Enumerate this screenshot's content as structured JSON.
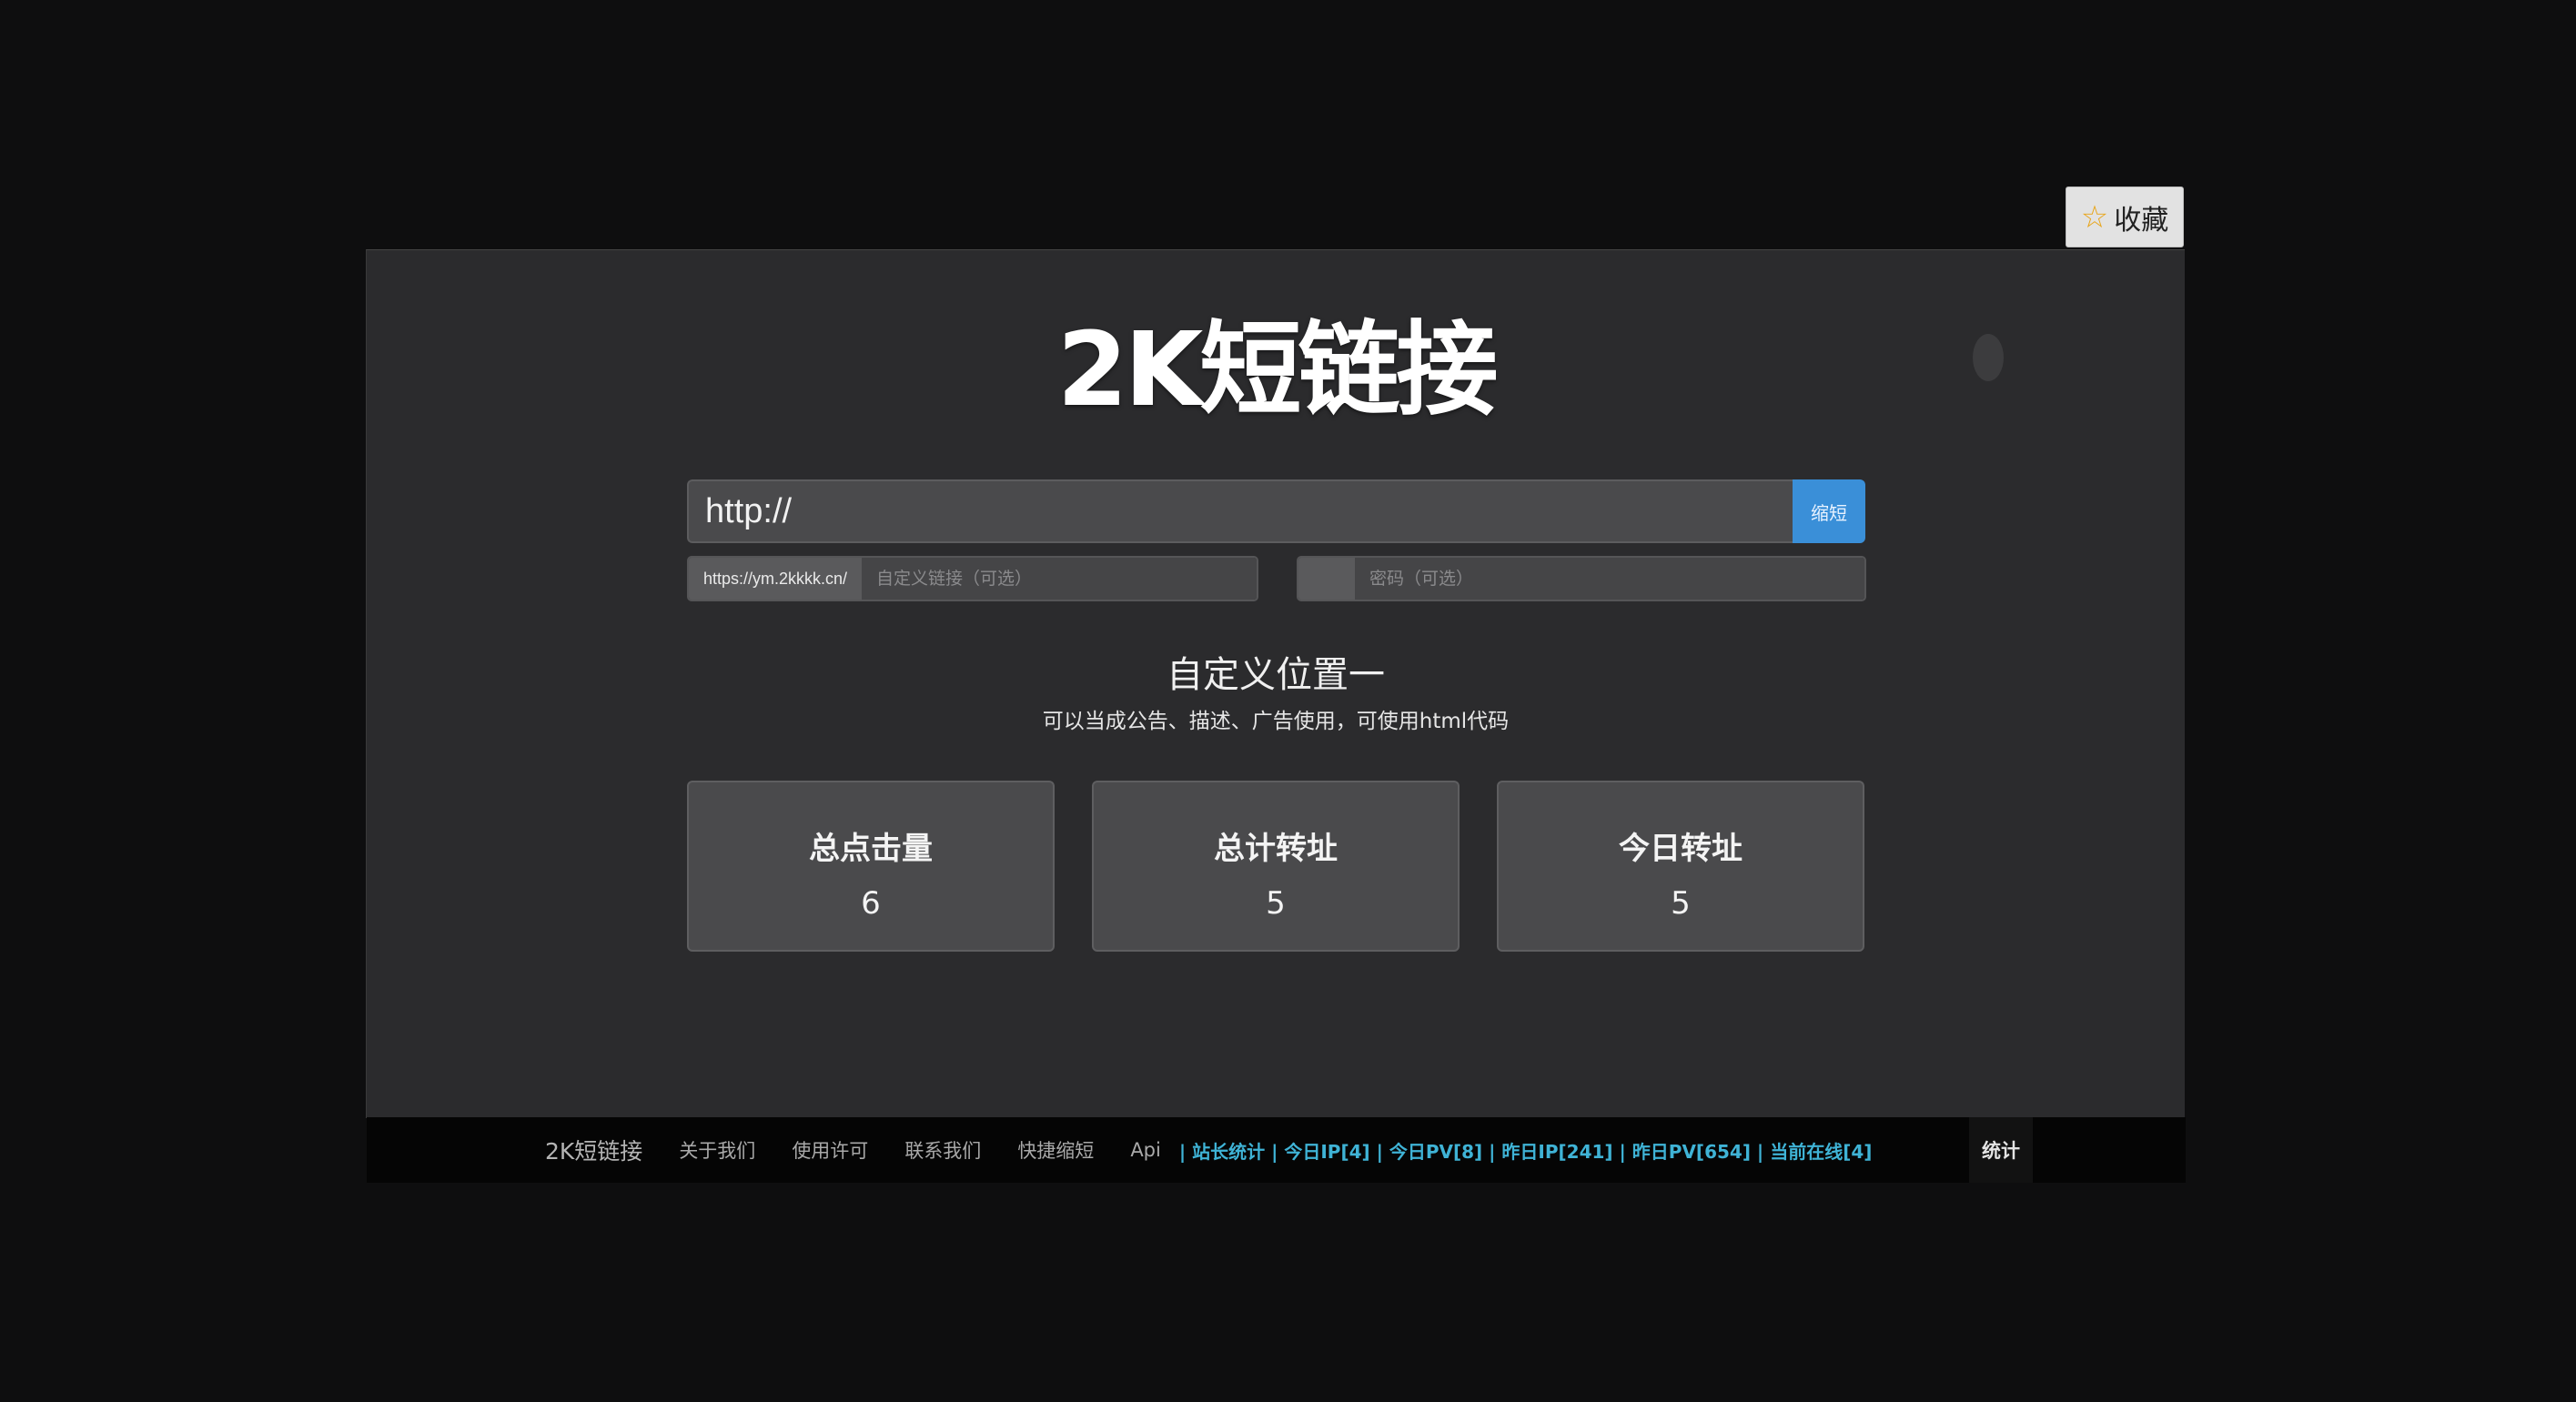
{
  "bookmark": {
    "label": "收藏",
    "icon": "star-icon"
  },
  "site": {
    "title": "2K短链接"
  },
  "url_form": {
    "url_placeholder": "http://",
    "shorten_label": "缩短",
    "domain_prefix": "https://ym.2kkkk.cn/",
    "alias_placeholder": "自定义链接（可选）",
    "password_placeholder": "密码（可选）"
  },
  "custom_block": {
    "title": "自定义位置一",
    "description": "可以当成公告、描述、广告使用，可使用html代码"
  },
  "stats": [
    {
      "label": "总点击量",
      "value": "6"
    },
    {
      "label": "总计转址",
      "value": "5"
    },
    {
      "label": "今日转址",
      "value": "5"
    }
  ],
  "footer": {
    "brand": "2K短链接",
    "links": [
      "关于我们",
      "使用许可",
      "联系我们",
      "快捷缩短",
      "Api"
    ],
    "site_stats": "| 站长统计 | 今日IP[4] | 今日PV[8] | 昨日IP[241] | 昨日PV[654] | 当前在线[4]",
    "stats_label": "统计"
  },
  "colors": {
    "page_bg": "#0e0e0f",
    "panel_bg": "#2b2b2d",
    "accent_blue": "#3a8fd8",
    "stats_link": "#3fb3d6"
  }
}
